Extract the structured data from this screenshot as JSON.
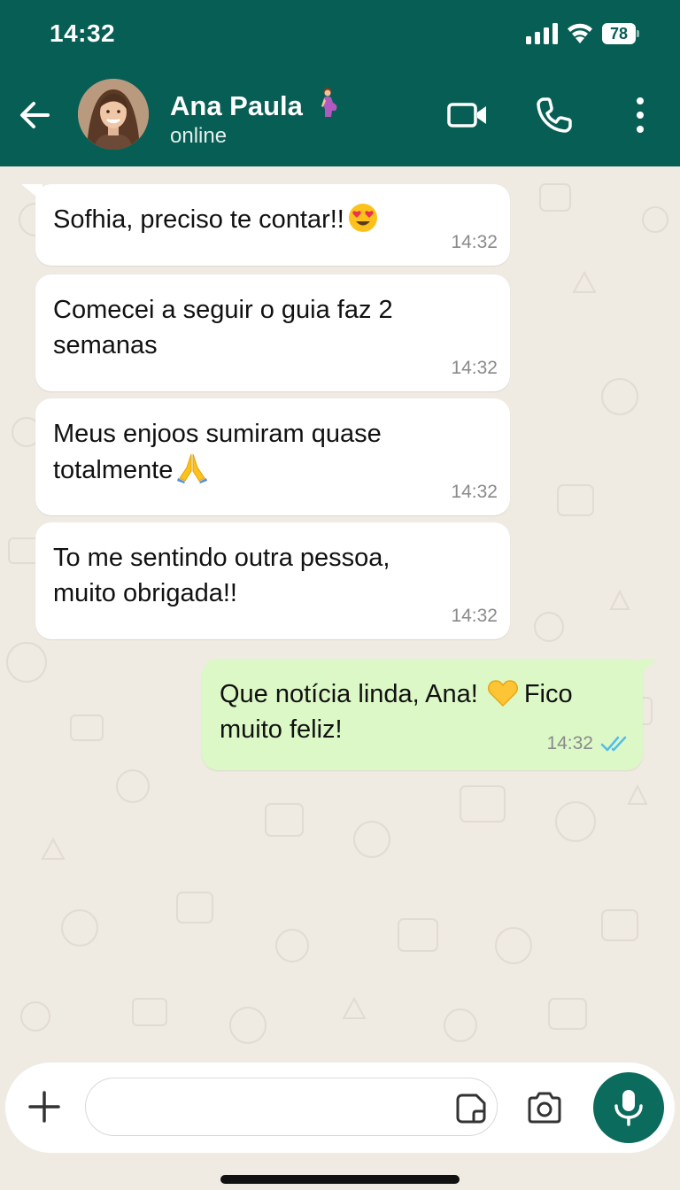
{
  "status_bar": {
    "time": "14:32",
    "battery": "78"
  },
  "header": {
    "contact_name": "Ana Paula",
    "contact_status": "online",
    "name_icon": "pregnant-woman-icon",
    "actions": [
      "back-arrow-icon",
      "video-camera-icon",
      "phone-icon",
      "more-vertical-icon"
    ]
  },
  "messages": [
    {
      "direction": "incoming",
      "text": "Sofhia, preciso te contar!!",
      "emoji": "heart-eyes-emoji",
      "time": "14:32"
    },
    {
      "direction": "incoming",
      "line1": "Comecei a seguir o guia faz 2",
      "line2": "semanas",
      "time": "14:32"
    },
    {
      "direction": "incoming",
      "line1": "Meus enjoos sumiram quase",
      "line2": "totalmente",
      "emoji": "folded-hands-emoji",
      "time": "14:32"
    },
    {
      "direction": "incoming",
      "line1": "To me sentindo outra pessoa,",
      "line2": "muito obrigada!!",
      "time": "14:32"
    },
    {
      "direction": "outgoing",
      "line1a": "Que notícia linda, Ana!",
      "emoji": "yellow-heart-emoji",
      "line1b": "Fico",
      "line2": "muito feliz!",
      "time": "14:32",
      "status": "read",
      "tick_color": "#53bdeb"
    }
  ],
  "input_bar": {
    "placeholder": "",
    "icons": [
      "plus-icon",
      "sticker-icon",
      "camera-icon",
      "microphone-icon"
    ]
  },
  "colors": {
    "header": "#075e54",
    "wallpaper": "#efeae2",
    "incoming_bubble": "#ffffff",
    "outgoing_bubble": "#dcf8c6",
    "mic_button": "#0b6b5c"
  }
}
